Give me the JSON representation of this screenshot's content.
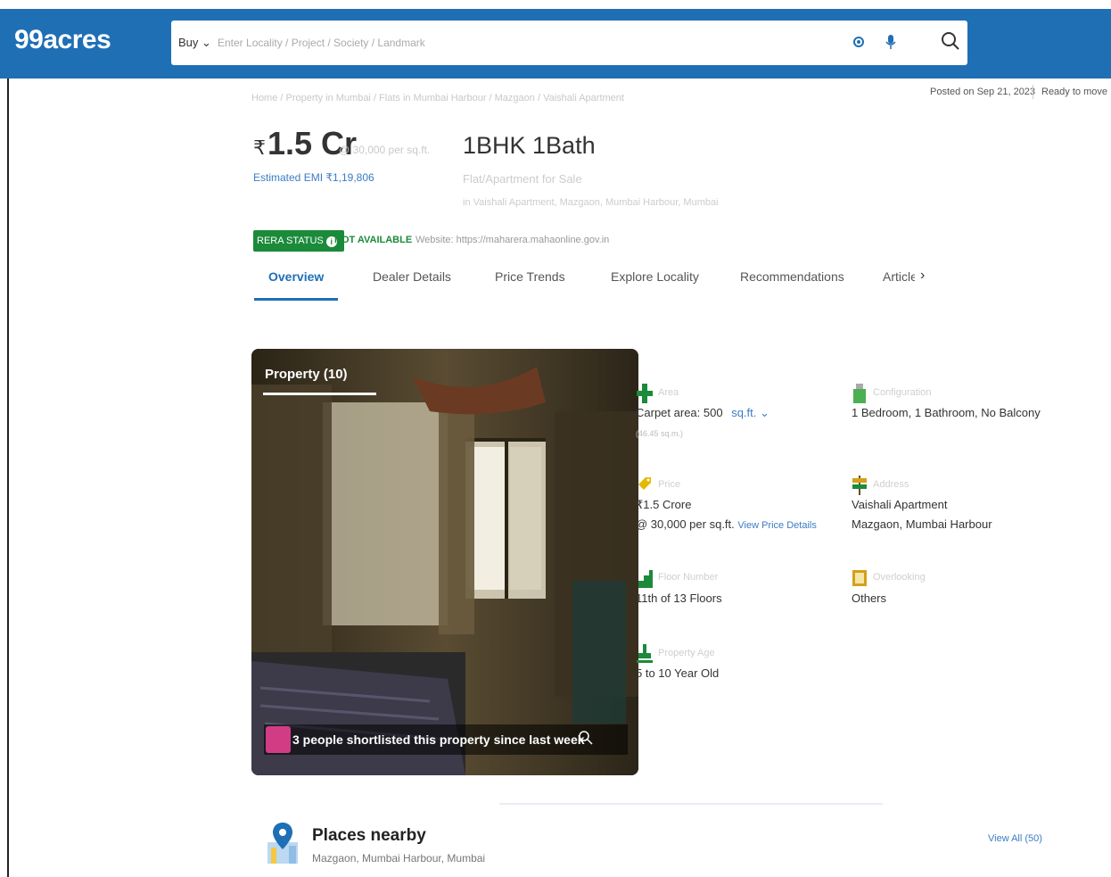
{
  "header": {
    "logo": "99acres",
    "buy_label": "Buy ⌄",
    "search_placeholder": "Enter Locality / Project / Society / Landmark"
  },
  "breadcrumb": "Home / Property in Mumbai / Flats in Mumbai Harbour / Mazgaon / Vaishali Apartment",
  "posted_on": "Posted on Sep 21, 2023",
  "status": "Ready to move",
  "price": {
    "currency": "₹",
    "amount": "1.5 Cr",
    "per_sqft": "@ 30,000 per sq.ft.",
    "emi": "Estimated EMI ₹1,19,806"
  },
  "summary": {
    "bhk": "1BHK 1Bath",
    "type": "Flat/Apartment for Sale",
    "address": "in Vaishali Apartment, Mazgaon, Mumbai Harbour, Mumbai"
  },
  "rera": {
    "badge": "RERA STATUS",
    "status": "NOT AVAILABLE",
    "website": "Website: https://maharera.mahaonline.gov.in"
  },
  "tabs": [
    "Overview",
    "Dealer Details",
    "Price Trends",
    "Explore Locality",
    "Recommendations",
    "Article"
  ],
  "photo": {
    "label": "Property (10)",
    "shortlist": "3 people shortlisted this property since last week"
  },
  "details": {
    "area": {
      "label": "Area",
      "value": "Carpet area: 500",
      "unit": "sq.ft. ⌄",
      "sub": "(46.45 sq.m.)"
    },
    "configuration": {
      "label": "Configuration",
      "value": "1 Bedroom,  1 Bathroom, No Balcony"
    },
    "price": {
      "label": "Price",
      "value": "₹1.5 Crore",
      "per": "@ 30,000 per sq.ft.",
      "link": "View Price Details"
    },
    "address": {
      "label": "Address",
      "line1": "Vaishali Apartment",
      "line2": "Mazgaon, Mumbai Harbour"
    },
    "floor": {
      "label": "Floor Number",
      "value": "11th  of 13 Floors"
    },
    "overlooking": {
      "label": "Overlooking",
      "value": "Others"
    },
    "age": {
      "label": "Property Age",
      "value": "5 to 10 Year Old"
    }
  },
  "places": {
    "title": "Places nearby",
    "subtitle": "Mazgaon, Mumbai Harbour, Mumbai",
    "view_all": "View All (50)"
  },
  "colors": {
    "brand_blue": "#1f6fb5",
    "rera_green": "#1b8a3a",
    "link_blue": "#3b7cc4",
    "shortlist_pink": "#d13c85"
  }
}
